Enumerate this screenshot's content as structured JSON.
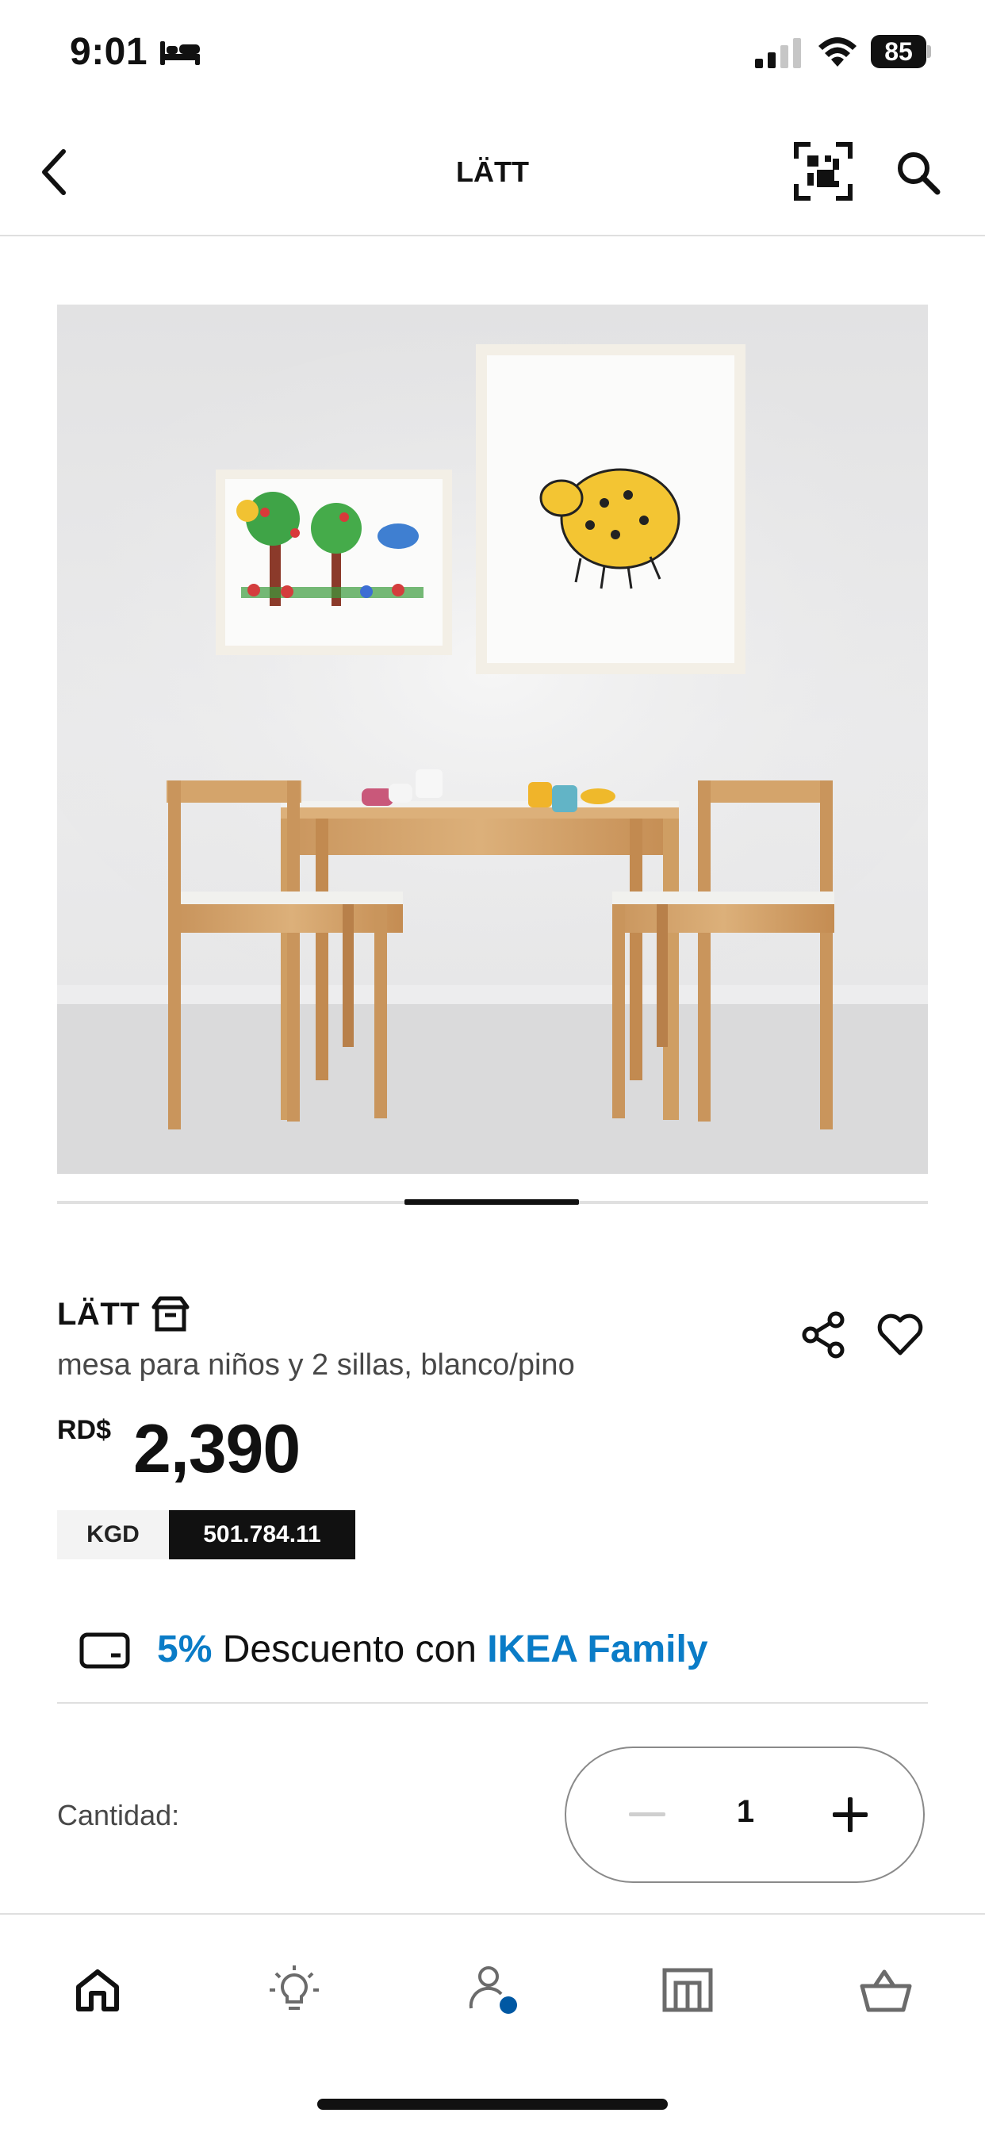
{
  "status_bar": {
    "time": "9:01",
    "battery": "85",
    "icons": [
      "bed-icon",
      "signal-icon",
      "wifi-icon",
      "battery-icon"
    ]
  },
  "header": {
    "title": "LÄTT",
    "icons": [
      "back-chevron-icon",
      "qr-scan-icon",
      "search-icon"
    ]
  },
  "product_image": {
    "carousel": {
      "current": 3,
      "total": 5
    }
  },
  "product": {
    "name": "LÄTT",
    "description": "mesa para niños y 2 sillas, blanco/pino",
    "currency": "RD$",
    "price": "2,390",
    "article_prefix": "KGD",
    "article_number": "501.784.11",
    "icons": [
      "package-box-icon",
      "share-icon",
      "heart-icon"
    ]
  },
  "family_offer": {
    "discount": "5%",
    "text": " Descuento con ",
    "brand": "IKEA Family",
    "icon": "card-icon",
    "accent_color": "#0a7cc7"
  },
  "quantity": {
    "label": "Cantidad:",
    "value": "1"
  },
  "tab_bar": {
    "items": [
      "home-icon",
      "lightbulb-icon",
      "profile-icon",
      "store-icon",
      "basket-icon"
    ],
    "notification_color": "#0058a3"
  }
}
